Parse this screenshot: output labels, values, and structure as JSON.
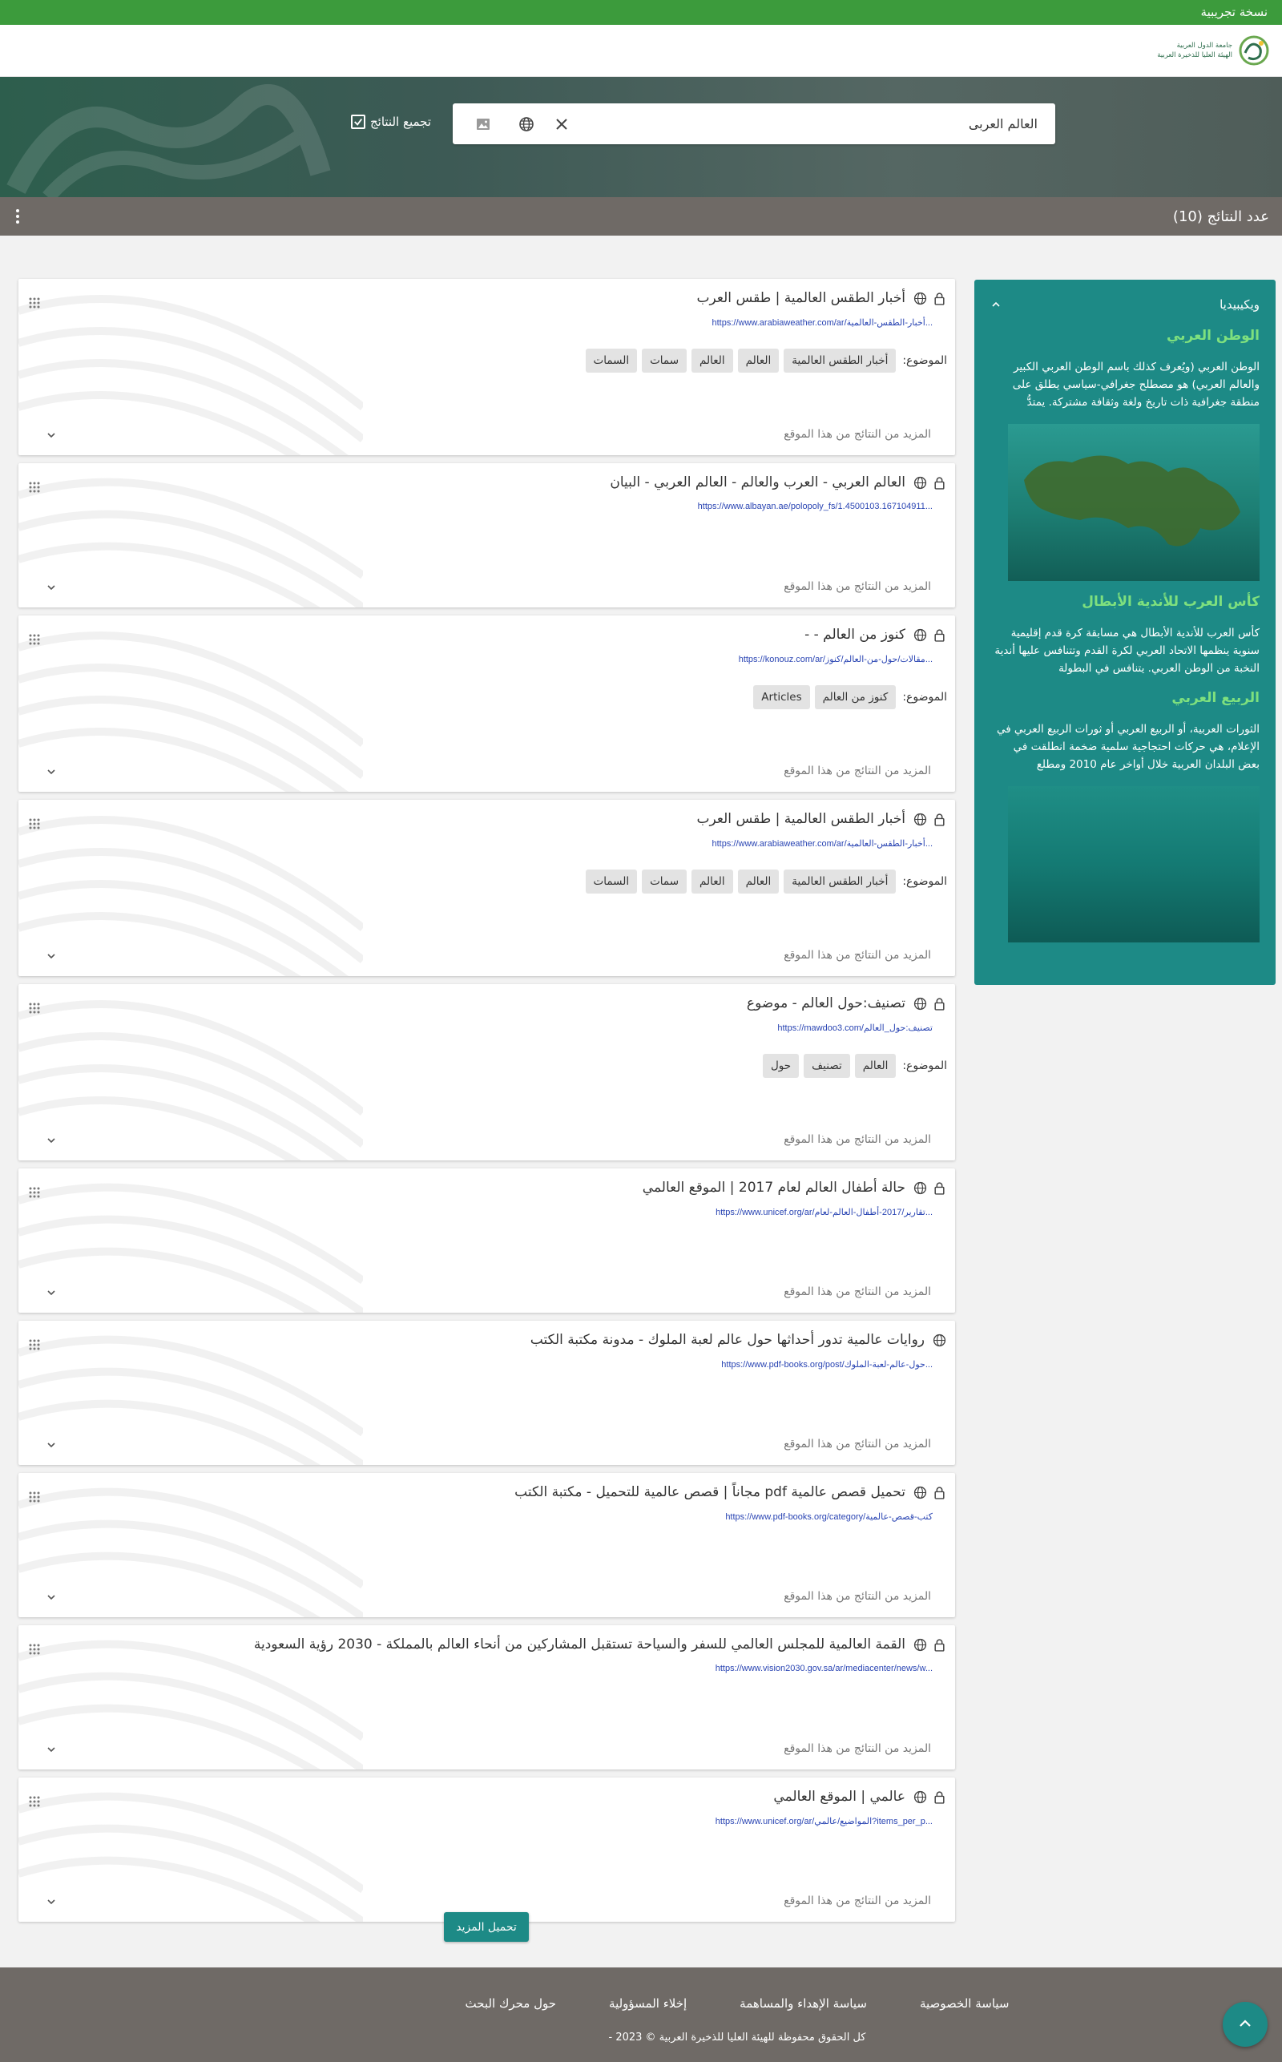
{
  "banner": {
    "beta_label": "نسخة تجريبية"
  },
  "header": {
    "logo_line1": "جامعة الدول العربية",
    "logo_line2": "الهيئة العليا للذخيرة العربية"
  },
  "search": {
    "query": "العالم العربى",
    "group_results_label": "تجميع النتائج",
    "group_results_checked": true
  },
  "results_bar": {
    "count_label": "عدد النتائج (10)"
  },
  "wikipedia": {
    "heading": "ويكيبيديا",
    "entries": [
      {
        "title": "الوطن العربي",
        "text": "الوطن العربي (ويُعرف كذلك باسم الوطن العربي الكبير والعالم العربي) هو مصطلح جغرافي-سياسي يطلق على منطقة جغرافية ذات تاريخ ولغة وثقافة مشتركة. يمتدُّ"
      },
      {
        "title": "كأس العرب للأندية الأبطال",
        "text": "كأس العرب للأندية الأبطال هي مسابقة كرة قدم إقليمية سنوية ينظمها الاتحاد العربي لكرة القدم وتتنافس عليها أندية النخبة من الوطن العربي. يتنافس في البطولة"
      },
      {
        "title": "الربيع العربي",
        "text": "الثورات العربية، أو الربيع العربي أو ثورات الربيع العربي في الإعلام، هي حركات احتجاجية سلمية ضخمة انطلقت في بعض البلدان العربية خلال أواخر عام 2010 ومطلع"
      }
    ]
  },
  "results": [
    {
      "title": "أخبار الطقس العالمية | طقس العرب",
      "url": "https://www.arabiaweather.com/ar/أخبار-الطقس-العالمية...",
      "tags_label": "الموضوع:",
      "tags": [
        "أخبار الطقس العالمية",
        "العالم",
        "العالم",
        "سمات",
        "السمات"
      ],
      "more": "المزيد من النتائج من هذا الموقع"
    },
    {
      "title": "العالم العربي - العرب والعالم - العالم العربي - البيان",
      "url": "https://www.albayan.ae/polopoly_fs/1.4500103.1671049​11...",
      "tags_label": "",
      "tags": [],
      "more": "المزيد من النتائج من هذا الموقع"
    },
    {
      "title": "كنوز من العالم - -",
      "url": "https://konouz.com/ar/مقالات/حول-من-العالم/كنوز...",
      "tags_label": "الموضوع:",
      "tags": [
        "كنوز من العالم",
        "Articles"
      ],
      "more": "المزيد من النتائج من هذا الموقع"
    },
    {
      "title": "أخبار الطقس العالمية | طقس العرب",
      "url": "https://www.arabiaweather.com/ar/أخبار-الطقس-العالمية...",
      "tags_label": "الموضوع:",
      "tags": [
        "أخبار الطقس العالمية",
        "العالم",
        "العالم",
        "سمات",
        "السمات"
      ],
      "more": "المزيد من النتائج من هذا الموقع"
    },
    {
      "title": "تصنيف:حول العالم - موضوع",
      "url": "https://mawdoo3.com/تصنيف:حول_العالم",
      "tags_label": "الموضوع:",
      "tags": [
        "العالم",
        "تصنيف",
        "حول"
      ],
      "more": "المزيد من النتائج من هذا الموقع"
    },
    {
      "title": "حالة أطفال العالم لعام 2017 | الموقع العالمي",
      "url": "https://www.unicef.org/ar/تقارير/2017-أطفال-العالم-لعام...",
      "tags_label": "",
      "tags": [],
      "more": "المزيد من النتائج من هذا الموقع"
    },
    {
      "title": "روايات عالمية تدور أحداثها حول عالم لعبة الملوك - مدونة مكتبة الكتب",
      "url": "https://www.pdf-books.org/post/حول-عالم-لعبة-الملوك...",
      "tags_label": "",
      "tags": [],
      "more": "المزيد من النتائج من هذا الموقع"
    },
    {
      "title": "تحميل قصص عالمية pdf مجاناً | قصص عالمية للتحميل - مكتبة الكتب",
      "url": "https://www.pdf-books.org/category/كتب-قصص-عالمية",
      "tags_label": "",
      "tags": [],
      "more": "المزيد من النتائج من هذا الموقع"
    },
    {
      "title": "القمة العالمية للمجلس العالمي للسفر والسياحة تستقبل المشاركين من أنحاء العالم بالمملكة - 2030 رؤية السعودية",
      "url": "https://www.vision2030.gov.sa/ar/mediacenter/news/w...",
      "tags_label": "",
      "tags": [],
      "more": "المزيد من النتائج من هذا الموقع"
    },
    {
      "title": "عالمي | الموقع العالمي",
      "url": "https://www.unicef.org/ar/المواضيع/عالمي?items_per_p...",
      "tags_label": "",
      "tags": [],
      "more": "المزيد من النتائج من هذا الموقع"
    }
  ],
  "load_more_label": "تحميل المزيد",
  "footer": {
    "links": [
      "سياسة الخصوصية",
      "سياسة الإهداء والمساهمة",
      "إخلاء المسؤولية",
      "حول محرك البحث"
    ],
    "copyright": "كل الحقوق محفوظة للهيئة العليا للذخيرة العربية © 2023 -"
  },
  "colors": {
    "beta_green": "#3c9b3c",
    "teal": "#1d8a86",
    "bar_gray": "#6f6a66",
    "wiki_heading": "#7ee07e",
    "url_blue": "#2a45b3"
  }
}
